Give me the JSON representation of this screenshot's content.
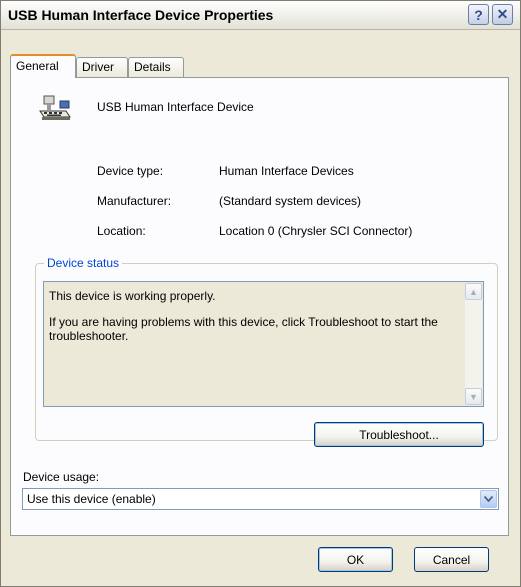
{
  "window": {
    "title": "USB Human Interface Device Properties"
  },
  "titlebar": {
    "help_label": "?",
    "close_label": "✕"
  },
  "tabs": [
    "General",
    "Driver",
    "Details"
  ],
  "device": {
    "name": "USB Human Interface Device",
    "icon": "usb-keyboard-device-icon",
    "properties": [
      {
        "label": "Device type:",
        "value": "Human Interface Devices"
      },
      {
        "label": "Manufacturer:",
        "value": "(Standard system devices)"
      },
      {
        "label": "Location:",
        "value": "Location 0 (Chrysler SCI Connector)"
      }
    ]
  },
  "status": {
    "group_title": "Device status",
    "line1": "This device is working properly.",
    "line2": "If you are having problems with this device, click Troubleshoot to start the troubleshooter.",
    "troubleshoot_label": "Troubleshoot..."
  },
  "usage": {
    "label": "Device usage:",
    "selected": "Use this device (enable)"
  },
  "buttons": {
    "ok": "OK",
    "cancel": "Cancel"
  }
}
